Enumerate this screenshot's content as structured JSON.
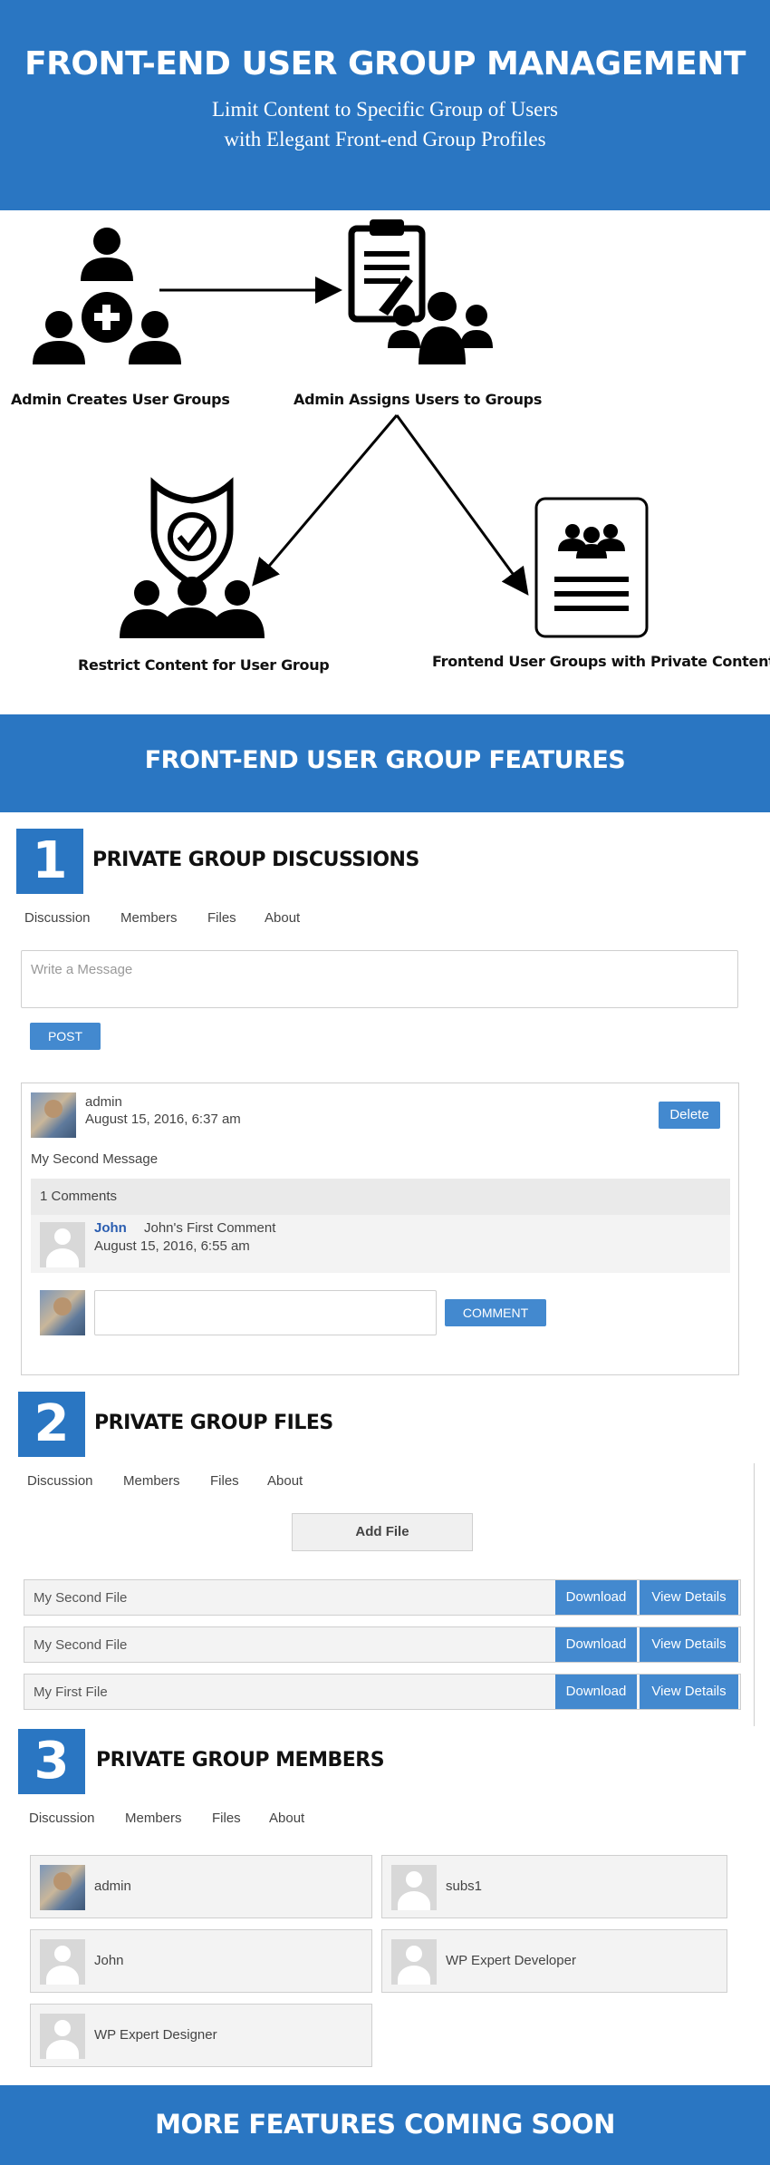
{
  "hero": {
    "title": "FRONT-END USER GROUP MANAGEMENT",
    "subtitle_line1": "Limit Content to Specific Group of Users",
    "subtitle_line2": "with Elegant Front-end Group Profiles"
  },
  "diagram": {
    "step1": "Admin Creates User Groups",
    "step2": "Admin Assigns Users to Groups",
    "step3": "Restrict Content for User Group",
    "step4": "Frontend User Groups with Private Content"
  },
  "features_banner": "FRONT-END USER GROUP FEATURES",
  "tabs": [
    "Discussion",
    "Members",
    "Files",
    "About"
  ],
  "section1": {
    "number": "1",
    "title": "PRIVATE GROUP DISCUSSIONS",
    "message_placeholder": "Write a Message",
    "post_button": "POST",
    "post": {
      "author": "admin",
      "date": "August 15, 2016, 6:37 am",
      "delete_button": "Delete",
      "body": "My Second Message",
      "comments_count": "1 Comments",
      "comment": {
        "author": "John",
        "text": "John's First Comment",
        "date": "August 15, 2016, 6:55 am"
      },
      "comment_button": "COMMENT"
    }
  },
  "section2": {
    "number": "2",
    "title": "PRIVATE GROUP FILES",
    "add_file_button": "Add File",
    "download_label": "Download",
    "view_details_label": "View Details",
    "files": [
      "My Second File",
      "My Second File",
      "My First File"
    ]
  },
  "section3": {
    "number": "3",
    "title": "PRIVATE GROUP MEMBERS",
    "members": [
      "admin",
      "subs1",
      "John",
      "WP Expert Developer",
      "WP Expert Designer"
    ]
  },
  "footer_banner": "MORE FEATURES COMING SOON",
  "colors": {
    "brand_blue": "#2a76c2",
    "button_blue": "#4389cf",
    "link_blue": "#2a5db0"
  }
}
